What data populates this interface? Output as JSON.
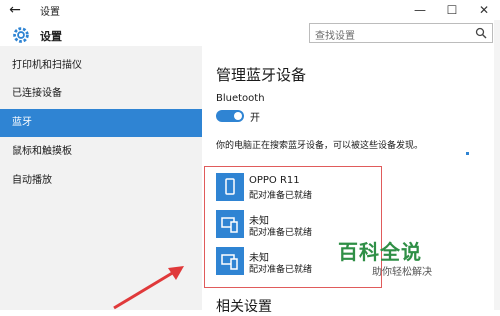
{
  "window": {
    "title": "设置"
  },
  "header": {
    "app_title": "设置"
  },
  "search": {
    "placeholder": "查找设置"
  },
  "sidebar": {
    "items": [
      {
        "label": "打印机和扫描仪"
      },
      {
        "label": "已连接设备"
      },
      {
        "label": "蓝牙",
        "active": true
      },
      {
        "label": "鼠标和触摸板"
      },
      {
        "label": "自动播放"
      }
    ]
  },
  "main": {
    "title": "管理蓝牙设备",
    "bluetooth_label": "Bluetooth",
    "toggle_state": "开",
    "status_text": "你的电脑正在搜索蓝牙设备，可以被这些设备发现。",
    "devices": [
      {
        "name": "OPPO R11",
        "status": "配对准备已就绪",
        "icon": "phone-icon"
      },
      {
        "name": "未知",
        "status": "配对准备已就绪",
        "icon": "computer-phone-icon"
      },
      {
        "name": "未知",
        "status": "配对准备已就绪",
        "icon": "computer-phone-icon"
      }
    ],
    "related_heading": "相关设置"
  },
  "watermark": {
    "logo": "百科全说",
    "sub": "助你轻松解决"
  },
  "colors": {
    "accent": "#2f84d3",
    "highlight_border": "#e05b5b",
    "arrow": "#e0393a",
    "watermark": "#2f8f46"
  }
}
